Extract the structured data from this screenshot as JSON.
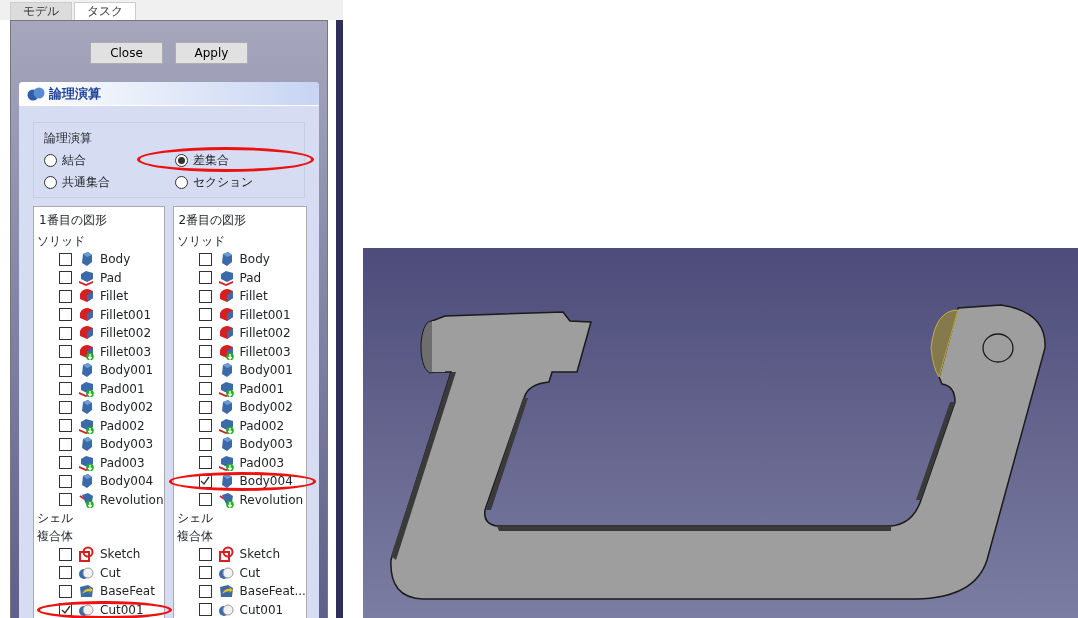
{
  "tabs": [
    {
      "label": "モデル",
      "selected": false
    },
    {
      "label": "タスク",
      "selected": true
    }
  ],
  "buttons": [
    "Close",
    "Apply"
  ],
  "task_panel": {
    "title": "論理演算",
    "group": {
      "label": "論理演算",
      "options": [
        {
          "label": "結合",
          "selected": false
        },
        {
          "label": "差集合",
          "selected": true
        },
        {
          "label": "共通集合",
          "selected": false
        },
        {
          "label": "セクション",
          "selected": false
        }
      ]
    }
  },
  "lists": [
    {
      "title": "1番目の図形",
      "sections": [
        {
          "label": "ソリッド",
          "items": [
            {
              "label": "Body",
              "kind": "body",
              "checked": false
            },
            {
              "label": "Pad",
              "kind": "pad",
              "checked": false
            },
            {
              "label": "Fillet",
              "kind": "fillet",
              "checked": false
            },
            {
              "label": "Fillet001",
              "kind": "fillet",
              "checked": false
            },
            {
              "label": "Fillet002",
              "kind": "fillet",
              "checked": false
            },
            {
              "label": "Fillet003",
              "kind": "fillet-linked",
              "checked": false
            },
            {
              "label": "Body001",
              "kind": "body",
              "checked": false
            },
            {
              "label": "Pad001",
              "kind": "pad-linked",
              "checked": false
            },
            {
              "label": "Body002",
              "kind": "body",
              "checked": false
            },
            {
              "label": "Pad002",
              "kind": "pad-linked",
              "checked": false
            },
            {
              "label": "Body003",
              "kind": "body",
              "checked": false
            },
            {
              "label": "Pad003",
              "kind": "pad-linked",
              "checked": false
            },
            {
              "label": "Body004",
              "kind": "body",
              "checked": false
            },
            {
              "label": "Revolution",
              "kind": "revolution",
              "checked": false
            }
          ]
        },
        {
          "label": "シェル"
        },
        {
          "label": "複合体",
          "items": [
            {
              "label": "Sketch",
              "kind": "sketch",
              "checked": false
            },
            {
              "label": "Cut",
              "kind": "cut",
              "checked": false
            },
            {
              "label": "BaseFeat",
              "kind": "basefeature",
              "checked": false
            },
            {
              "label": "Cut001",
              "kind": "cut",
              "checked": true
            }
          ]
        }
      ]
    },
    {
      "title": "2番目の図形",
      "sections": [
        {
          "label": "ソリッド",
          "items": [
            {
              "label": "Body",
              "kind": "body",
              "checked": false
            },
            {
              "label": "Pad",
              "kind": "pad",
              "checked": false
            },
            {
              "label": "Fillet",
              "kind": "fillet",
              "checked": false
            },
            {
              "label": "Fillet001",
              "kind": "fillet",
              "checked": false
            },
            {
              "label": "Fillet002",
              "kind": "fillet",
              "checked": false
            },
            {
              "label": "Fillet003",
              "kind": "fillet-linked",
              "checked": false
            },
            {
              "label": "Body001",
              "kind": "body",
              "checked": false
            },
            {
              "label": "Pad001",
              "kind": "pad-linked",
              "checked": false
            },
            {
              "label": "Body002",
              "kind": "body",
              "checked": false
            },
            {
              "label": "Pad002",
              "kind": "pad-linked",
              "checked": false
            },
            {
              "label": "Body003",
              "kind": "body",
              "checked": false
            },
            {
              "label": "Pad003",
              "kind": "pad-linked",
              "checked": false
            },
            {
              "label": "Body004",
              "kind": "body",
              "checked": true
            },
            {
              "label": "Revolution",
              "kind": "revolution",
              "checked": false
            }
          ]
        },
        {
          "label": "シェル"
        },
        {
          "label": "複合体",
          "items": [
            {
              "label": "Sketch",
              "kind": "sketch",
              "checked": false
            },
            {
              "label": "Cut",
              "kind": "cut",
              "checked": false
            },
            {
              "label": "BaseFeat...",
              "kind": "basefeature",
              "checked": false
            },
            {
              "label": "Cut001",
              "kind": "cut",
              "checked": false
            }
          ]
        }
      ]
    }
  ]
}
